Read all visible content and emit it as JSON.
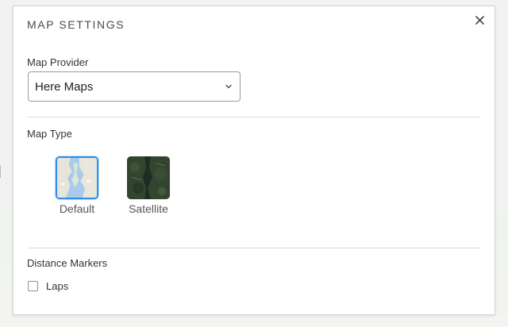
{
  "modal": {
    "title": "MAP SETTINGS",
    "close_icon": "close-icon"
  },
  "map_provider": {
    "label": "Map Provider",
    "selected": "Here Maps",
    "chevron_icon": "chevron-down-icon"
  },
  "map_type": {
    "label": "Map Type",
    "options": [
      {
        "label": "Default",
        "selected": true,
        "icon": "map-default-thumbnail"
      },
      {
        "label": "Satellite",
        "selected": false,
        "icon": "map-satellite-thumbnail"
      }
    ]
  },
  "distance_markers": {
    "label": "Distance Markers",
    "laps": {
      "label": "Laps",
      "checked": false
    }
  },
  "colors": {
    "selected_border": "#2f8ee5",
    "text_primary": "#333333",
    "divider": "#dcdcdc"
  }
}
